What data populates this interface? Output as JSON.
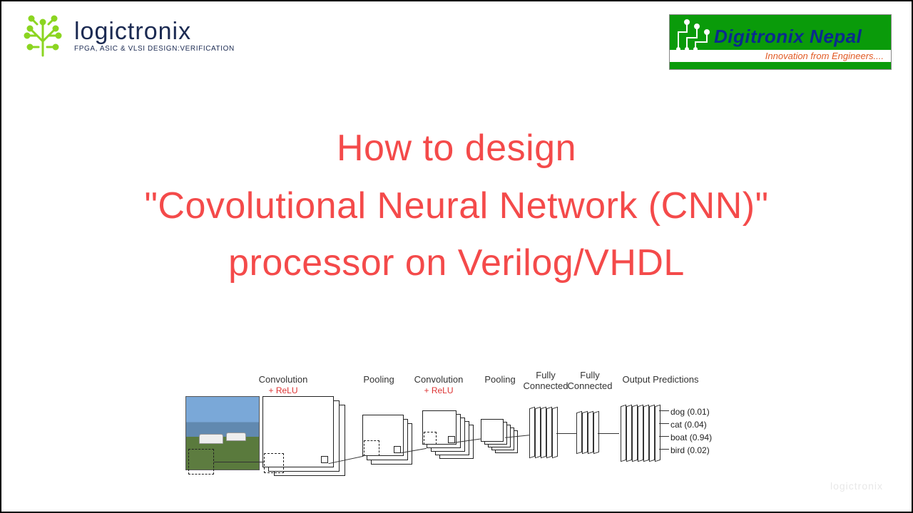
{
  "colors": {
    "title": "#f44a4a",
    "brand_navy": "#1b2a52",
    "dn_green": "#0a9b0a",
    "dn_blue": "#0b2a8e",
    "dn_orange": "#e15b25",
    "logo_green": "#8bd521"
  },
  "logo_left": {
    "word": "logictronix",
    "sub": "FPGA, ASIC & VLSI Design:Verification"
  },
  "logo_right": {
    "title": "Digitronix Nepal",
    "sub": "Innovation from Engineers...."
  },
  "title": {
    "line1": "How to design",
    "line2": "\"Covolutional Neural Network (CNN)\"",
    "line3": "processor on Verilog/VHDL"
  },
  "diagram": {
    "stages": {
      "conv1": "Convolution",
      "relu": "+ ReLU",
      "pool1": "Pooling",
      "conv2": "Convolution",
      "pool2": "Pooling",
      "fc1": "Fully\nConnected",
      "fc2": "Fully\nConnected",
      "out": "Output Predictions"
    },
    "predictions": [
      {
        "label": "dog",
        "p": "0.01"
      },
      {
        "label": "cat",
        "p": "0.04"
      },
      {
        "label": "boat",
        "p": "0.94"
      },
      {
        "label": "bird",
        "p": "0.02"
      }
    ]
  },
  "watermark": "logictronix"
}
